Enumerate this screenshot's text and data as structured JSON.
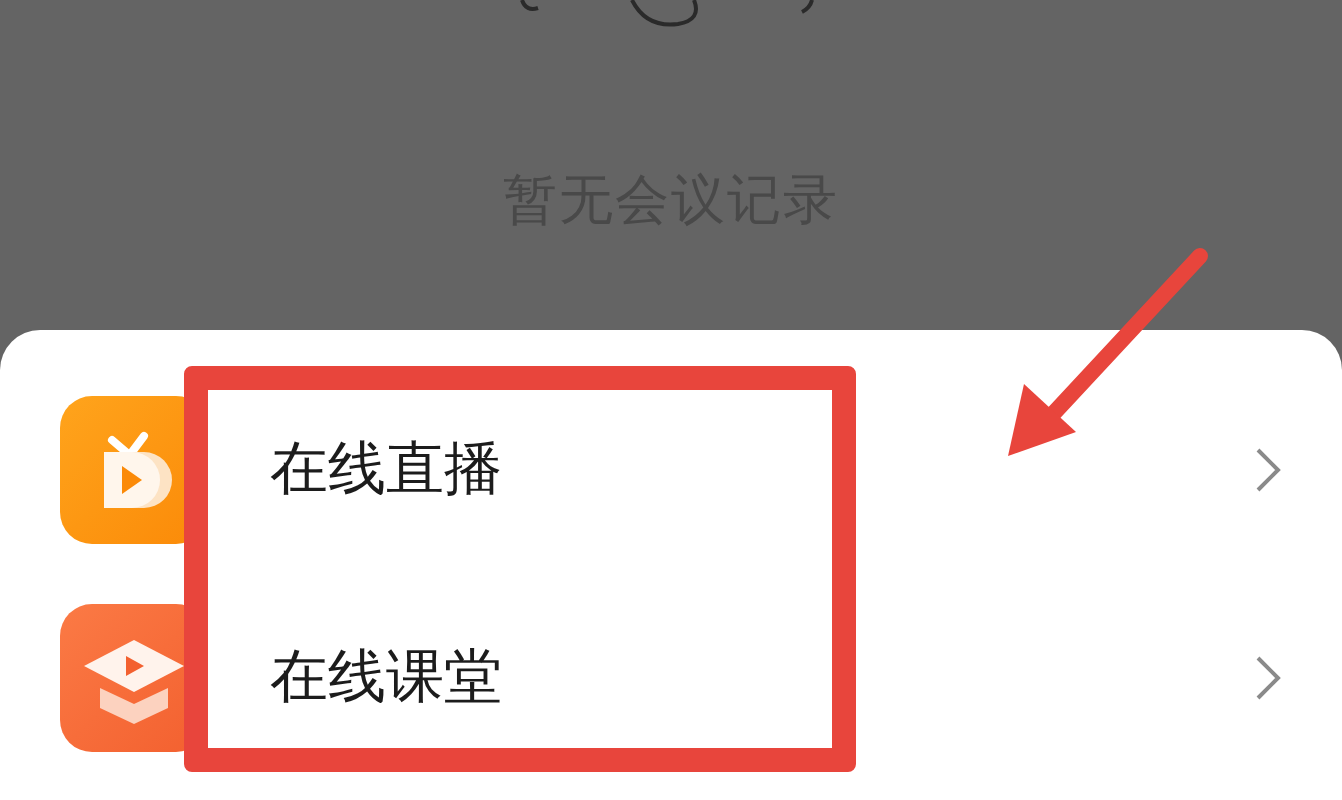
{
  "empty_state": {
    "message": "暂无会议记录"
  },
  "menu_items": [
    {
      "kind": "live",
      "label": "在线直播"
    },
    {
      "kind": "classroom",
      "label": "在线课堂"
    }
  ],
  "annotations": [
    {
      "kind": "box"
    },
    {
      "kind": "arrow"
    }
  ]
}
